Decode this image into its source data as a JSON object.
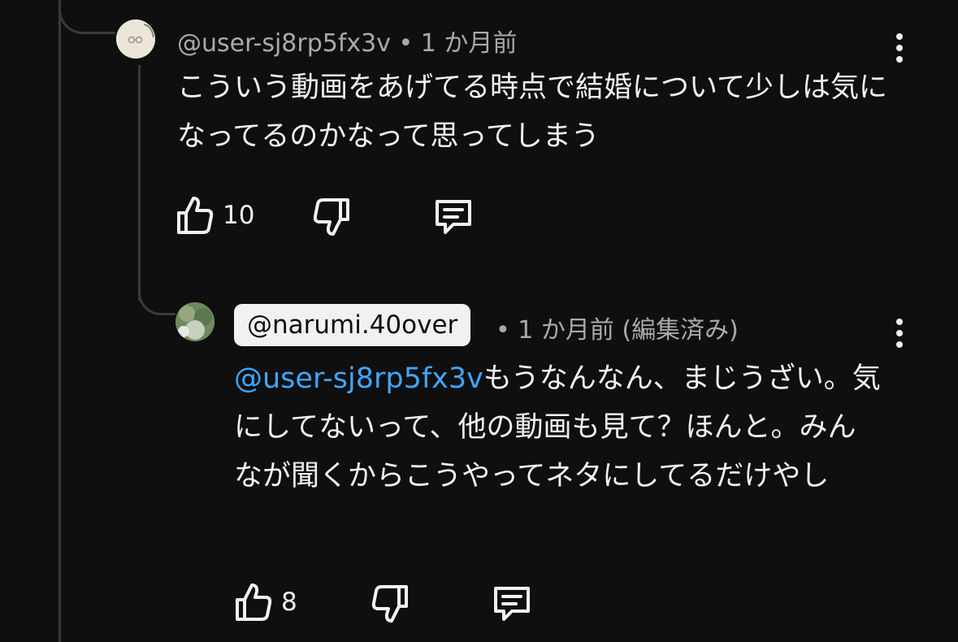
{
  "comment": {
    "author": "@user-sj8rp5fx3v",
    "meta": "@user-sj8rp5fx3v • 1 か月前",
    "text": "こういう動画をあげてる時点で結婚について少しは気になってるのかなって思ってしまう",
    "likes": "10",
    "icons": [
      "like-icon",
      "dislike-icon",
      "reply-icon",
      "more-icon"
    ]
  },
  "reply": {
    "author": "@narumi.40over",
    "meta": "• 1 か月前 (編集済み)",
    "mention": "@user-sj8rp5fx3v",
    "text": "もうなんなん、まじうざい。気にしてないって、他の動画も見て？ほんと。みんなが聞くからこうやってネタにしてるだけやし",
    "likes": "8",
    "icons": [
      "like-icon",
      "dislike-icon",
      "reply-icon",
      "more-icon"
    ]
  },
  "colors": {
    "background": "#0f0f0f",
    "text": "#f1f1f1",
    "meta": "#aaaaaa",
    "mention": "#3ea6ff",
    "thread_line": "#3a3a3a"
  }
}
